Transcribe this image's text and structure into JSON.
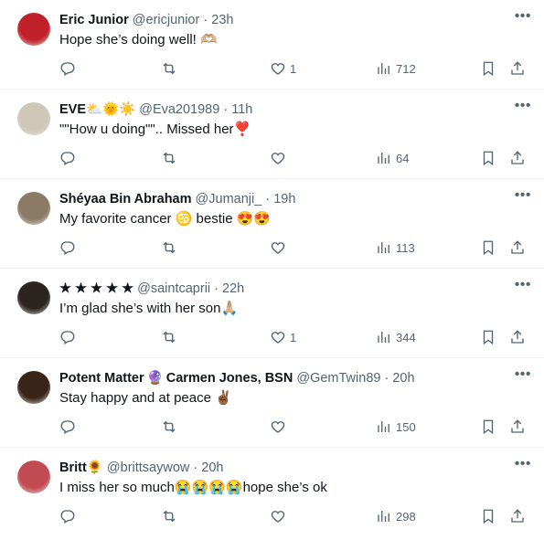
{
  "colors": {
    "text": "#0f1419",
    "secondary": "#536471",
    "border": "#eff3f4"
  },
  "tweets": [
    {
      "name": "Eric Junior",
      "handle": "@ericjunior",
      "dot": "·",
      "time": "23h",
      "text": "Hope she’s doing well! 🫶🏼",
      "likes": "1",
      "views": "712",
      "avatar": "#c0202a"
    },
    {
      "name": "EVE",
      "name_emoji": "⛅🌞☀️",
      "handle": "@Eva201989",
      "dot": "·",
      "time": "11h",
      "text": "\"\"How u doing\"\".. Missed her❣️",
      "likes": "",
      "views": "64",
      "avatar": "#cfc7b8"
    },
    {
      "name": "Shéyaa Bin Abraham",
      "handle": "@Jumanji_",
      "dot": "·",
      "time": "19h",
      "text": "My favorite cancer ♋ bestie 😍😍",
      "likes": "",
      "views": "113",
      "avatar": "#8a7a66"
    },
    {
      "name": "★ ★ ★ ★ ★",
      "handle": "@saintcaprii",
      "dot": "·",
      "time": "22h",
      "text": "I’m glad she’s with her son🙏🏼",
      "likes": "1",
      "views": "344",
      "avatar": "#2b2420"
    },
    {
      "name": "Potent Matter",
      "name_emoji": "🔮",
      "name2": "Carmen Jones, BSN",
      "handle": "@GemTwin89",
      "dot": "·",
      "time": "20h",
      "text": "Stay happy and at peace ✌🏾",
      "likes": "",
      "views": "150",
      "avatar": "#3a2418"
    },
    {
      "name": "Britt",
      "name_emoji": "🌻",
      "handle": "@brittsaywow",
      "dot": "·",
      "time": "20h",
      "text": "I miss her so much😭😭😭😭hope she’s ok",
      "likes": "",
      "views": "298",
      "avatar": "#c24a52"
    }
  ],
  "icons": [
    "reply-icon",
    "retweet-icon",
    "like-icon",
    "views-icon",
    "bookmark-icon",
    "share-icon",
    "more-icon"
  ]
}
